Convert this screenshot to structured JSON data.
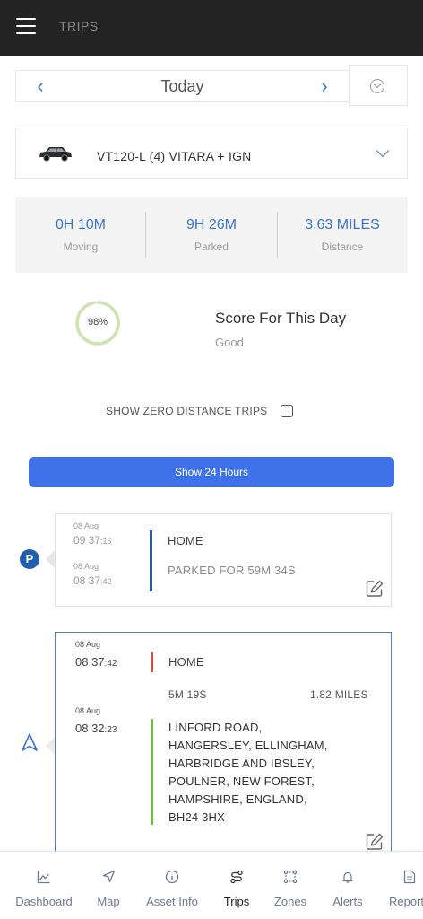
{
  "header": {
    "title": "TRIPS"
  },
  "date_nav": {
    "label": "Today",
    "prev_icon": "chevron-left-icon",
    "next_icon": "chevron-right-icon",
    "download_icon": "download-icon"
  },
  "vehicle": {
    "name": "VT120-L (4) VITARA + IGN",
    "icon": "car-icon"
  },
  "stats": [
    {
      "value": "0H 10M",
      "label": "Moving"
    },
    {
      "value": "9H 26M",
      "label": "Parked"
    },
    {
      "value": "3.63 MILES",
      "label": "Distance"
    }
  ],
  "score": {
    "percent_text": "98%",
    "percent": 98,
    "title": "Score For This Day",
    "rating": "Good",
    "ring_color": "#cfe3b0"
  },
  "filters": {
    "zero_distance_label": "SHOW ZERO DISTANCE TRIPS",
    "zero_distance_checked": false
  },
  "show24_label": "Show 24 Hours",
  "accent_color": "#3f72e8",
  "timeline": {
    "parked": {
      "marker": "P",
      "start_date": "08 Aug",
      "start_time": "09 37",
      "start_sec": ":16",
      "end_date": "08 Aug",
      "end_time": "08 37",
      "end_sec": ":42",
      "location": "HOME",
      "duration_text": "PARKED FOR 59M 34S",
      "bar_color": "#1d5fae"
    },
    "trip": {
      "end_date": "08 Aug",
      "end_time": "08 37",
      "end_sec": ":42",
      "end_location": "HOME",
      "duration": "5M 19S",
      "distance": "1.82 MILES",
      "start_date": "08 Aug",
      "start_time": "08 32",
      "start_sec": ":23",
      "start_address": [
        "LINFORD ROAD,",
        "HANGERSLEY, ELLINGHAM,",
        "HARBRIDGE AND IBSLEY,",
        "POULNER, NEW FOREST,",
        "HAMPSHIRE, ENGLAND,",
        "BH24 3HX"
      ],
      "end_bar_color": "#d9463a",
      "start_bar_color": "#6ac13a"
    }
  },
  "tabs": [
    {
      "label": "Dashboard",
      "icon": "chart-line-icon",
      "active": false
    },
    {
      "label": "Map",
      "icon": "navigation-arrow-icon",
      "active": false
    },
    {
      "label": "Asset Info",
      "icon": "info-circle-icon",
      "active": false
    },
    {
      "label": "Trips",
      "icon": "route-icon",
      "active": true
    },
    {
      "label": "Zones",
      "icon": "zones-icon",
      "active": false
    },
    {
      "label": "Alerts",
      "icon": "bell-icon",
      "active": false
    },
    {
      "label": "Report",
      "icon": "report-icon",
      "active": false
    }
  ]
}
